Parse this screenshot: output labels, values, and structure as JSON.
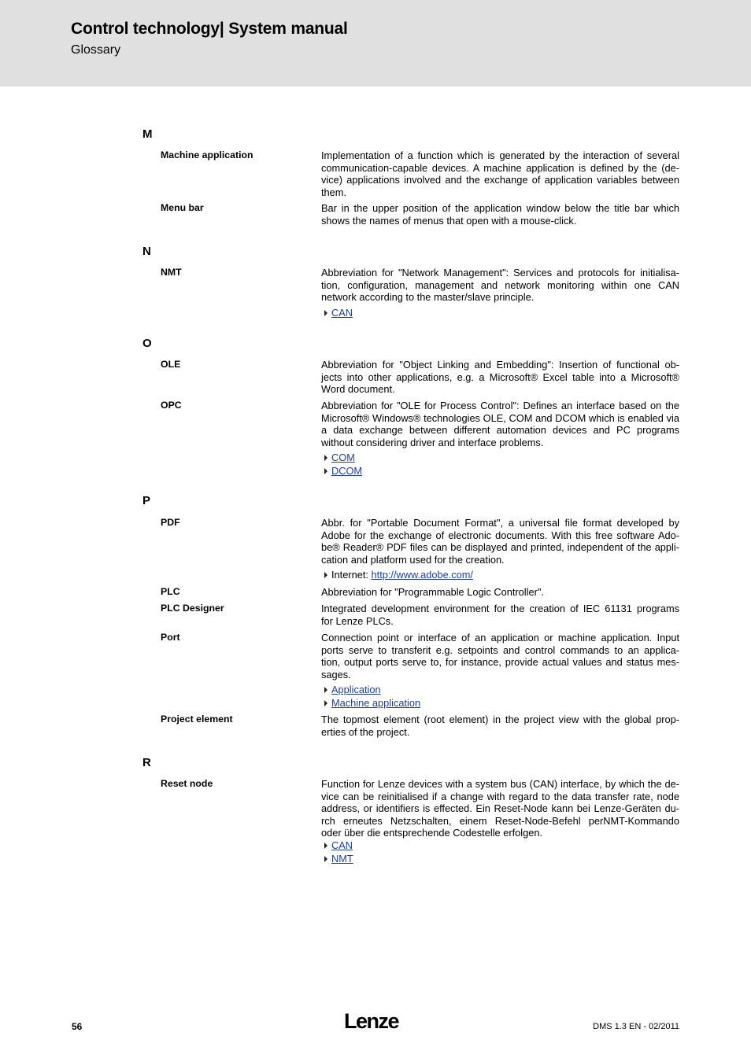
{
  "header": {
    "title": "Control technology| System manual",
    "subtitle": "Glossary"
  },
  "sections": {
    "M": {
      "letter": "M",
      "entries": [
        {
          "term": "Machine application",
          "lines": [
            "Implementation of a function which is generated by the interaction of several",
            "communication-capable devices. A machine application is defined by the (de-",
            "vice) applications involved and the exchange of application variables between",
            "them."
          ]
        },
        {
          "term": "Menu bar",
          "lines": [
            "Bar in the upper position of the application window below the title bar which",
            "shows the names of menus that open with a mouse-click."
          ]
        }
      ]
    },
    "N": {
      "letter": "N",
      "entries": [
        {
          "term": "NMT",
          "lines": [
            "Abbreviation for \"Network Management\": Services and protocols for initialisa-",
            "tion, configuration, management and network monitoring within one CAN",
            "network according to the master/slave principle."
          ],
          "links": [
            "CAN"
          ]
        }
      ]
    },
    "O": {
      "letter": "O",
      "entries": [
        {
          "term": "OLE",
          "lines": [
            "Abbreviation for \"Object Linking and Embedding\": Insertion of functional ob-",
            "jects into other applications, e.g. a Microsoft® Excel table into a Microsoft®",
            "Word document."
          ]
        },
        {
          "term": "OPC",
          "lines": [
            "Abbreviation for \"OLE for Process Control\": Defines an interface based on the",
            "Microsoft® Windows® technologies OLE, COM and DCOM which is enabled via",
            "a data exchange between different automation devices and PC programs",
            "without considering driver and interface problems."
          ],
          "links": [
            "COM",
            "DCOM"
          ]
        }
      ]
    },
    "P": {
      "letter": "P",
      "entries": [
        {
          "term": "PDF",
          "lines": [
            "Abbr. for \"Portable Document Format\", a universal file format developed by",
            "Adobe for the exchange of electronic documents. With this free software Ado-",
            "be® Reader® PDF files can be displayed and printed, independent of the appli-",
            "cation and platform used for the creation."
          ],
          "internet_label": "Internet:",
          "internet_url": "http://www.adobe.com/"
        },
        {
          "term": "PLC",
          "lines": [
            "Abbreviation for \"Programmable Logic Controller\"."
          ]
        },
        {
          "term": "PLC Designer",
          "lines": [
            "Integrated development environment for the creation of IEC 61131 programs",
            "for Lenze PLCs."
          ]
        },
        {
          "term": "Port",
          "lines": [
            "Connection point or interface of an application or machine application. Input",
            "ports serve to transferit e.g. setpoints and control commands to an applica-",
            "tion, output ports serve to, for instance, provide actual values and status mes-",
            "sages."
          ],
          "links": [
            "Application",
            "Machine application"
          ]
        },
        {
          "term": "Project element",
          "lines": [
            "The topmost element (root element) in the project view with the global prop-",
            "erties of the project."
          ]
        }
      ]
    },
    "R": {
      "letter": "R",
      "entries": [
        {
          "term": "Reset node",
          "lines": [
            "Function for Lenze devices with a system bus (CAN) interface, by which the de-",
            "vice can be reinitialised if a change with regard to the data transfer rate, node",
            "address, or identifiers is effected. Ein Reset-Node kann bei Lenze-Geräten du-",
            "rch erneutes Netzschalten, einem Reset-Node-Befehl perNMT-Kommando",
            "oder über die entsprechende Codestelle erfolgen."
          ],
          "links": [
            "CAN",
            "NMT"
          ]
        }
      ]
    }
  },
  "footer": {
    "page_number": "56",
    "logo": "Lenze",
    "doc_info": "DMS 1.3 EN - 02/2011"
  }
}
